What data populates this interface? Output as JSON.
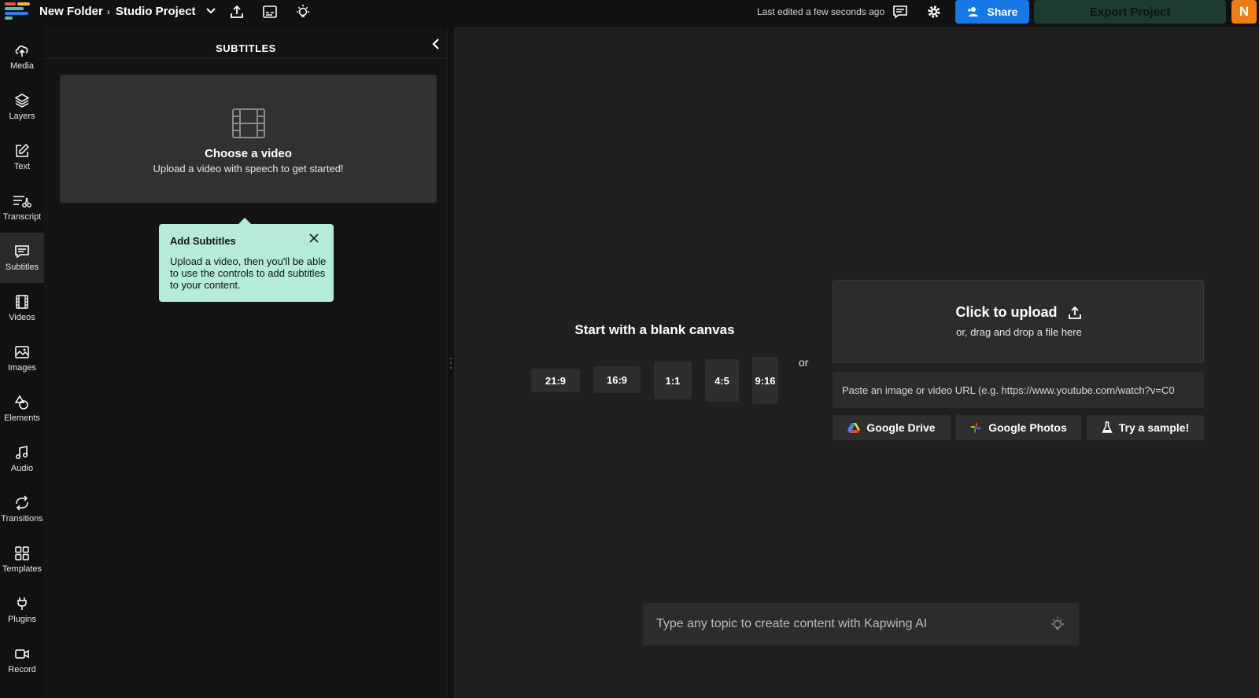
{
  "app": {
    "brand_colors": [
      "#e6584a",
      "#f5b53b",
      "#4ec3a8",
      "#3b78e6"
    ]
  },
  "header": {
    "folder": "New Folder",
    "separator": "›",
    "project": "Studio Project",
    "last_edited": "Last edited a few seconds ago",
    "share_label": "Share",
    "export_label": "Export Project",
    "avatar_initial": "N",
    "icons": [
      "chevron-down-icon",
      "upload-icon",
      "subtitle-icon",
      "lightbulb-icon",
      "comment-icon",
      "gear-icon",
      "add-user-icon"
    ],
    "colors": {
      "share": "#1677e6",
      "export": "#1d3b2f",
      "avatar": "#f07d14"
    }
  },
  "sidebar": {
    "items": [
      {
        "label": "Media",
        "icon": "media-upload-icon"
      },
      {
        "label": "Layers",
        "icon": "layers-icon"
      },
      {
        "label": "Text",
        "icon": "text-edit-icon"
      },
      {
        "label": "Transcript",
        "icon": "transcript-icon"
      },
      {
        "label": "Subtitles",
        "icon": "subtitles-icon",
        "active": true
      },
      {
        "label": "Videos",
        "icon": "film-icon"
      },
      {
        "label": "Images",
        "icon": "image-icon"
      },
      {
        "label": "Elements",
        "icon": "elements-icon"
      },
      {
        "label": "Audio",
        "icon": "music-note-icon"
      },
      {
        "label": "Transitions",
        "icon": "transitions-icon"
      },
      {
        "label": "Templates",
        "icon": "grid-icon"
      },
      {
        "label": "Plugins",
        "icon": "plug-icon"
      },
      {
        "label": "Record",
        "icon": "camera-icon"
      }
    ]
  },
  "panel": {
    "title": "SUBTITLES",
    "choose_title": "Choose a video",
    "choose_sub": "Upload a video with speech to get started!",
    "tooltip": {
      "title": "Add Subtitles",
      "body": "Upload a video, then you'll be able to use the controls to add subtitles to your content.",
      "color": "#b5ebd9"
    }
  },
  "canvas": {
    "blank_title": "Start with a blank canvas",
    "ratios": [
      "21:9",
      "16:9",
      "1:1",
      "4:5",
      "9:16"
    ],
    "or_text": "or",
    "upload_title": "Click to upload",
    "upload_sub": "or, drag and drop a file here",
    "url_placeholder": "Paste an image or video URL (e.g. https://www.youtube.com/watch?v=C0",
    "sources": [
      {
        "label": "Google Drive",
        "icon": "google-drive-icon"
      },
      {
        "label": "Google Photos",
        "icon": "google-photos-icon"
      },
      {
        "label": "Try a sample!",
        "icon": "flask-icon"
      }
    ],
    "ai_placeholder": "Type any topic to create content with Kapwing AI"
  }
}
